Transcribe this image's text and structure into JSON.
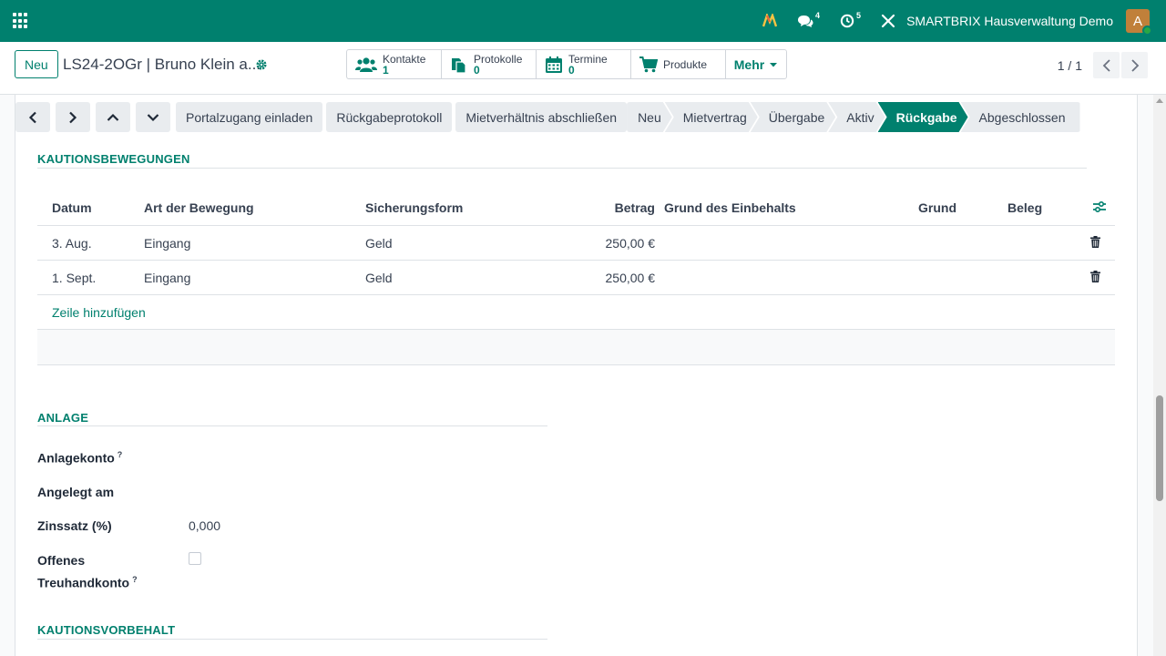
{
  "navbar": {
    "activity_count": "4",
    "messages_count": "4",
    "clock_count": "5",
    "company": "SMARTBRIX Hausverwaltung Demo",
    "avatar_letter": "A"
  },
  "control": {
    "new_label": "Neu",
    "record_title": "LS24-2OGr | Bruno Klein a...",
    "smart_buttons": [
      {
        "label": "Kontakte",
        "count": "1"
      },
      {
        "label": "Protokolle",
        "count": "0"
      },
      {
        "label": "Termine",
        "count": "0"
      },
      {
        "label": "Produkte",
        "count": ""
      }
    ],
    "more_label": "Mehr",
    "pager": "1 / 1"
  },
  "statusbar": {
    "actions": [
      "Portalzugang einladen",
      "Rückgabeprotokoll",
      "Mietverhältnis abschließen"
    ],
    "stages": [
      "Neu",
      "Mietvertrag",
      "Übergabe",
      "Aktiv",
      "Rückgabe",
      "Abgeschlossen"
    ],
    "active_stage": "Rückgabe"
  },
  "kaution": {
    "title": "KAUTIONSBEWEGUNGEN",
    "columns": [
      "Datum",
      "Art der Bewegung",
      "Sicherungsform",
      "Betrag",
      "Grund des Einbehalts",
      "Grund",
      "Beleg"
    ],
    "rows": [
      {
        "datum": "3. Aug.",
        "art": "Eingang",
        "form": "Geld",
        "betrag": "250,00 €"
      },
      {
        "datum": "1. Sept.",
        "art": "Eingang",
        "form": "Geld",
        "betrag": "250,00 €"
      }
    ],
    "add_line": "Zeile hinzufügen"
  },
  "anlage": {
    "title": "ANLAGE",
    "konto_label": "Anlagekonto",
    "angelegt_label": "Angelegt am",
    "zins_label": "Zinssatz (%)",
    "zins_value": "0,000",
    "treuhand_label_1": "Offenes",
    "treuhand_label_2": "Treuhandkonto",
    "help_mark": "?"
  },
  "vorbehalt": {
    "title": "KAUTIONSVORBEHALT"
  },
  "colors": {
    "brand": "#00806e",
    "stage_bg": "#e9ecef"
  }
}
